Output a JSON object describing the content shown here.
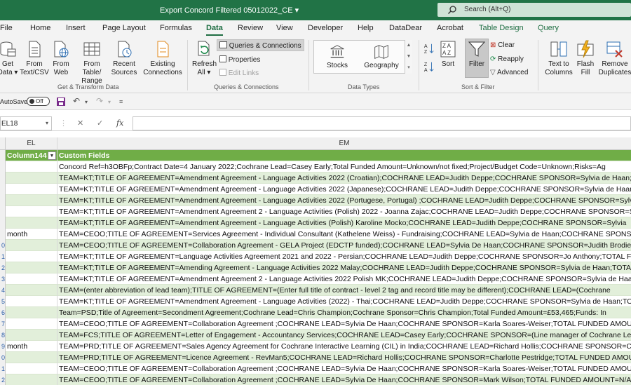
{
  "app": {
    "title": "Export Concord Filtered 05012022_CE",
    "title_caret": "▾",
    "search_placeholder": "Search (Alt+Q)",
    "accent_color": "#217346"
  },
  "menu": {
    "tabs": [
      "File",
      "Home",
      "Insert",
      "Page Layout",
      "Formulas",
      "Data",
      "Review",
      "View",
      "Developer",
      "Help",
      "DataDear",
      "Acrobat",
      "Table Design",
      "Query"
    ],
    "active_tab": "Data"
  },
  "ribbon": {
    "get_transform": {
      "get_data": [
        "Get",
        "Data ▾"
      ],
      "from_text": [
        "From",
        "Text/CSV"
      ],
      "from_web": [
        "From",
        "Web"
      ],
      "from_table": [
        "From Table/",
        "Range"
      ],
      "recent_sources": [
        "Recent",
        "Sources"
      ],
      "existing_connections": [
        "Existing",
        "Connections"
      ],
      "label": "Get & Transform Data"
    },
    "queries": {
      "refresh_all": [
        "Refresh",
        "All ▾"
      ],
      "queries_connections": "Queries & Connections",
      "properties": "Properties",
      "edit_links": "Edit Links",
      "label": "Queries & Connections"
    },
    "data_types": {
      "stocks": "Stocks",
      "geography": "Geography",
      "label": "Data Types"
    },
    "sort_filter": {
      "sort": "Sort",
      "filter": "Filter",
      "clear": "Clear",
      "reapply": "Reapply",
      "advanced": "Advanced",
      "label": "Sort & Filter"
    },
    "data_tools": {
      "text_to_columns": [
        "Text to",
        "Columns"
      ],
      "flash_fill": [
        "Flash",
        "Fill"
      ],
      "remove_duplicates": [
        "Remove",
        "Duplicates"
      ]
    }
  },
  "quick_access": {
    "autosave_label": "AutoSave",
    "autosave_state": "Off"
  },
  "formula_bar": {
    "name_box": "EL18",
    "formula": ""
  },
  "grid": {
    "columns": [
      "EL",
      "EM"
    ],
    "header_row": {
      "el": "Column144",
      "em": "Custom Fields"
    },
    "rows": [
      {
        "num": "",
        "el": "",
        "em": "Concord Ref=h3OBFp;Contract Date=4 January 2022;Cochrane Lead=Casey Early;Total Funded Amount=Unknown/not fixed;Project/Budget Code=Unknown;Risks=Ag"
      },
      {
        "num": "",
        "el": "",
        "em": "TEAM=KT;TITLE OF AGREEMENT=Amendment Agreement - Language Activities 2022 (Croatian);COCHRANE LEAD=Judith Deppe;COCHRANE SPONSOR=Sylvia de Haan;"
      },
      {
        "num": "",
        "el": "",
        "em": "TEAM=KT;TITLE OF AGREEMENT=Amendment Agreement - Language Activities 2022 (Japanese);COCHRANE LEAD=Judith Deppe;COCHRANE SPONSOR=Sylvia de Haan"
      },
      {
        "num": "",
        "el": "",
        "em": "TEAM=KT;TITLE OF AGREEMENT=Amendment Agreement - Language Activities 2022 (Portugese, Portugal) ;COCHRANE LEAD=Judith Deppe;COCHRANE SPONSOR=Sylv"
      },
      {
        "num": "",
        "el": "",
        "em": "TEAM=KT;TITLE OF AGREEMENT=Amendment Agreement 2 - Language Activities (Polish) 2022 - Joanna Zajac;COCHRANE LEAD=Judith Deppe;COCHRANE SPONSOR=Sy"
      },
      {
        "num": "",
        "el": "",
        "em": "TEAM=KT;TITLE OF AGREEMENT=Amendment Agreement - Language Activities (Polish) Karoline Mocko;COCHRANE LEAD=Judith Deppe;COCHRANE SPONSOR=Sylvia"
      },
      {
        "num": "",
        "el": "month",
        "em": "TEAM=CEOO;TITLE OF AGREEMENT=Services Agreement - Individual Consultant (Kathelene Weiss) - Fundraising;COCHRANE LEAD=Sylvia de Haan;COCHRANE SPONS"
      },
      {
        "num": "0",
        "el": "",
        "em": "TEAM=CEOO;TITLE OF AGREEMENT=Collaboration Agreement - GELA Project (EDCTP funded);COCHRANE LEAD=Sylvia De Haan;COCHRANE SPONSOR=Judith Brodie;FU"
      },
      {
        "num": "1",
        "el": "",
        "em": "TEAM=KT;TITLE OF AGREEMENT=Language Activities Agreement 2021 and 2022 - Persian;COCHRANE LEAD=Judith Deppe;COCHRANE SPONSOR=Jo Anthony;TOTAL FU"
      },
      {
        "num": "2",
        "el": "",
        "em": "TEAM=KT;TITLE OF AGREEMENT=Amending Agreement - Language Activities 2022 Malay;COCHRANE LEAD=Judith Deppe;COCHRANE SPONSOR=Sylvia de Haan;TOTAL"
      },
      {
        "num": "3",
        "el": "",
        "em": "TEAM=KT;TITLE OF AGREEMENT=Amendment Agreement 2 - Language Activities 2022 Polish MK;COCHRANE LEAD=Judith Deppe;COCHRANE SPONSOR=Sylvia de Haa"
      },
      {
        "num": "4",
        "el": "",
        "em": "TEAM=(enter abbreviation of lead team);TITLE OF AGREEMENT=(Enter full title of contract - level 2 tag and record title may be different);COCHRANE LEAD=(Cochrane"
      },
      {
        "num": "5",
        "el": "",
        "em": "TEAM=KT;TITLE OF AGREEMENT=Amendment Agreement - Language Activities (2022) - Thai;COCHRANE LEAD=Judith Deppe;COCHRANE SPONSOR=Sylvia de Haan;TO"
      },
      {
        "num": "6",
        "el": "",
        "em": "Team=PSD;Title of Agreement=Secondment Agreement;Cochrane Lead=Chris Champion;Cochrane Sponsor=Chris Champion;Total Funded Amount=£53,465;Funds: In"
      },
      {
        "num": "7",
        "el": "",
        "em": "TEAM=CEOO;TITLE OF AGREEMENT=Collaboration Agreement ;COCHRANE LEAD=Sylvia De Haan;COCHRANE SPONSOR=Karla Soares-Weiser;TOTAL FUNDED AMOUNT"
      },
      {
        "num": "8",
        "el": "",
        "em": "TEAM=FCS;TITLE OF AGREEMENT=Letter of Engagement - Accountancy Services;COCHRANE LEAD=Casey Early;COCHRANE SPONSOR=(Line manager of Cochrane Lead/"
      },
      {
        "num": "9",
        "el": "month",
        "em": "TEAM=PRD;TITLE OF AGREEMENT=Sales Agency Agreement for Cochrane Interactive Learning (CIL) in India;COCHRANE LEAD=Richard Hollis;COCHRANE SPONSOR=Ch"
      },
      {
        "num": "0",
        "el": "",
        "em": "TEAM=PRD;TITLE OF AGREEMENT=Licence Agreement - RevMan5;COCHRANE LEAD=Richard Hollis;COCHRANE SPONSOR=Charlotte Pestridge;TOTAL FUNDED AMOUNT"
      },
      {
        "num": "1",
        "el": "",
        "em": "TEAM=CEOO;TITLE OF AGREEMENT=Collaboration Agreement ;COCHRANE LEAD=Sylvia De Haan;COCHRANE SPONSOR=Karla Soares-Weiser;TOTAL FUNDED AMOUNT"
      },
      {
        "num": "2",
        "el": "",
        "em": "TEAM=CEOO;TITLE OF AGREEMENT=Collaboration Agreement ;COCHRANE LEAD=Sylvia De Haan;COCHRANE SPONSOR=Mark Wilson;TOTAL FUNDED AMOUNT=N/A;FU"
      }
    ],
    "header_color": "#70ad47",
    "band_color": "#e2efda"
  }
}
